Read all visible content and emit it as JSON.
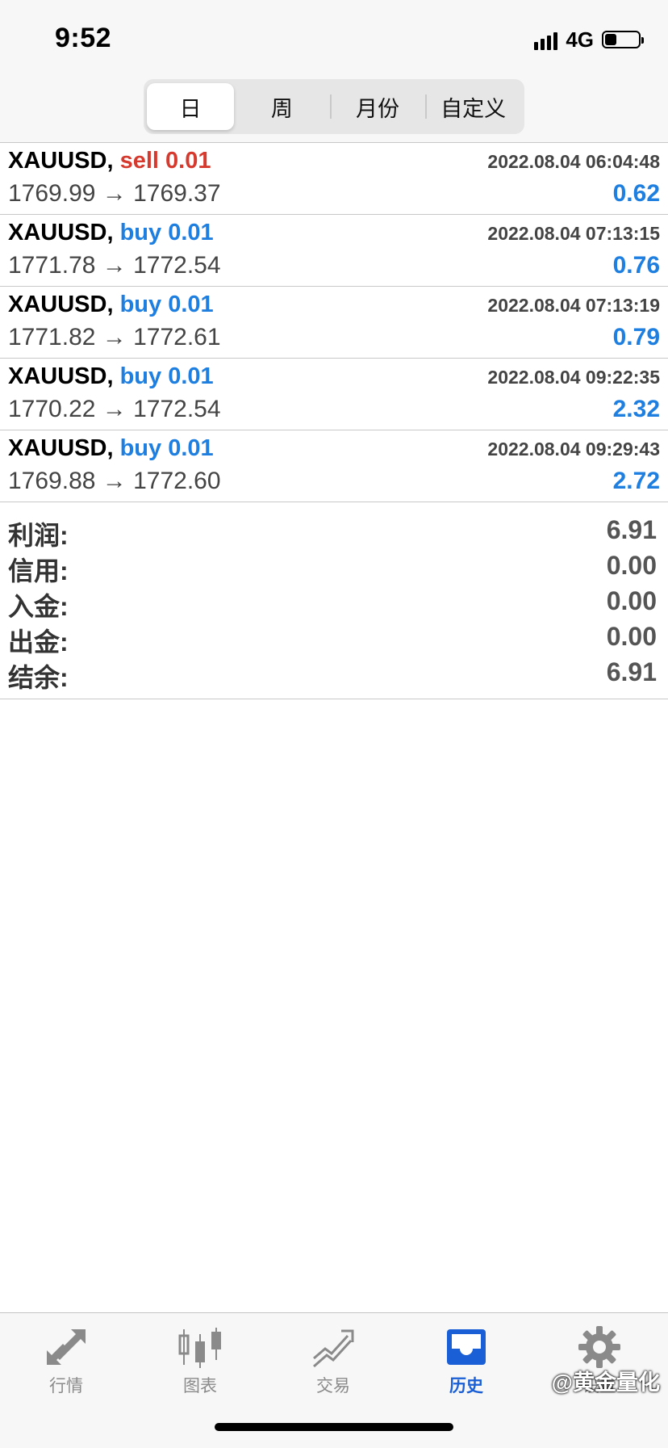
{
  "status_bar": {
    "time": "9:52",
    "network": "4G",
    "battery_level": 0.35
  },
  "segments": [
    {
      "label": "日",
      "active": true
    },
    {
      "label": "周",
      "active": false
    },
    {
      "label": "月份",
      "active": false
    },
    {
      "label": "自定义",
      "active": false
    }
  ],
  "trades": [
    {
      "symbol": "XAUUSD,",
      "type": "sell 0.01",
      "side": "sell",
      "time": "2022.08.04 06:04:48",
      "prices": "1769.99 → 1769.37",
      "profit": "0.62"
    },
    {
      "symbol": "XAUUSD,",
      "type": "buy 0.01",
      "side": "buy",
      "time": "2022.08.04 07:13:15",
      "prices": "1771.78 → 1772.54",
      "profit": "0.76"
    },
    {
      "symbol": "XAUUSD,",
      "type": "buy 0.01",
      "side": "buy",
      "time": "2022.08.04 07:13:19",
      "prices": "1771.82 → 1772.61",
      "profit": "0.79"
    },
    {
      "symbol": "XAUUSD,",
      "type": "buy 0.01",
      "side": "buy",
      "time": "2022.08.04 09:22:35",
      "prices": "1770.22 → 1772.54",
      "profit": "2.32"
    },
    {
      "symbol": "XAUUSD,",
      "type": "buy 0.01",
      "side": "buy",
      "time": "2022.08.04 09:29:43",
      "prices": "1769.88 → 1772.60",
      "profit": "2.72"
    }
  ],
  "summary": [
    {
      "label": "利润:",
      "value": "6.91"
    },
    {
      "label": "信用:",
      "value": "0.00"
    },
    {
      "label": "入金:",
      "value": "0.00"
    },
    {
      "label": "出金:",
      "value": "0.00"
    },
    {
      "label": "结余:",
      "value": "6.91"
    }
  ],
  "tabbar": [
    {
      "label": "行情",
      "icon": "quotes-arrows-icon",
      "active": false
    },
    {
      "label": "图表",
      "icon": "candlestick-chart-icon",
      "active": false
    },
    {
      "label": "交易",
      "icon": "trade-trend-icon",
      "active": false
    },
    {
      "label": "历史",
      "icon": "history-inbox-icon",
      "active": true
    },
    {
      "label": "设置",
      "icon": "gear-icon",
      "active": false
    }
  ],
  "watermark": "@黄金量化",
  "colors": {
    "sell": "#d63a2e",
    "buy": "#1e7fe0",
    "active_tab": "#1a5fd6",
    "inactive_tab": "#8a8a8a"
  }
}
